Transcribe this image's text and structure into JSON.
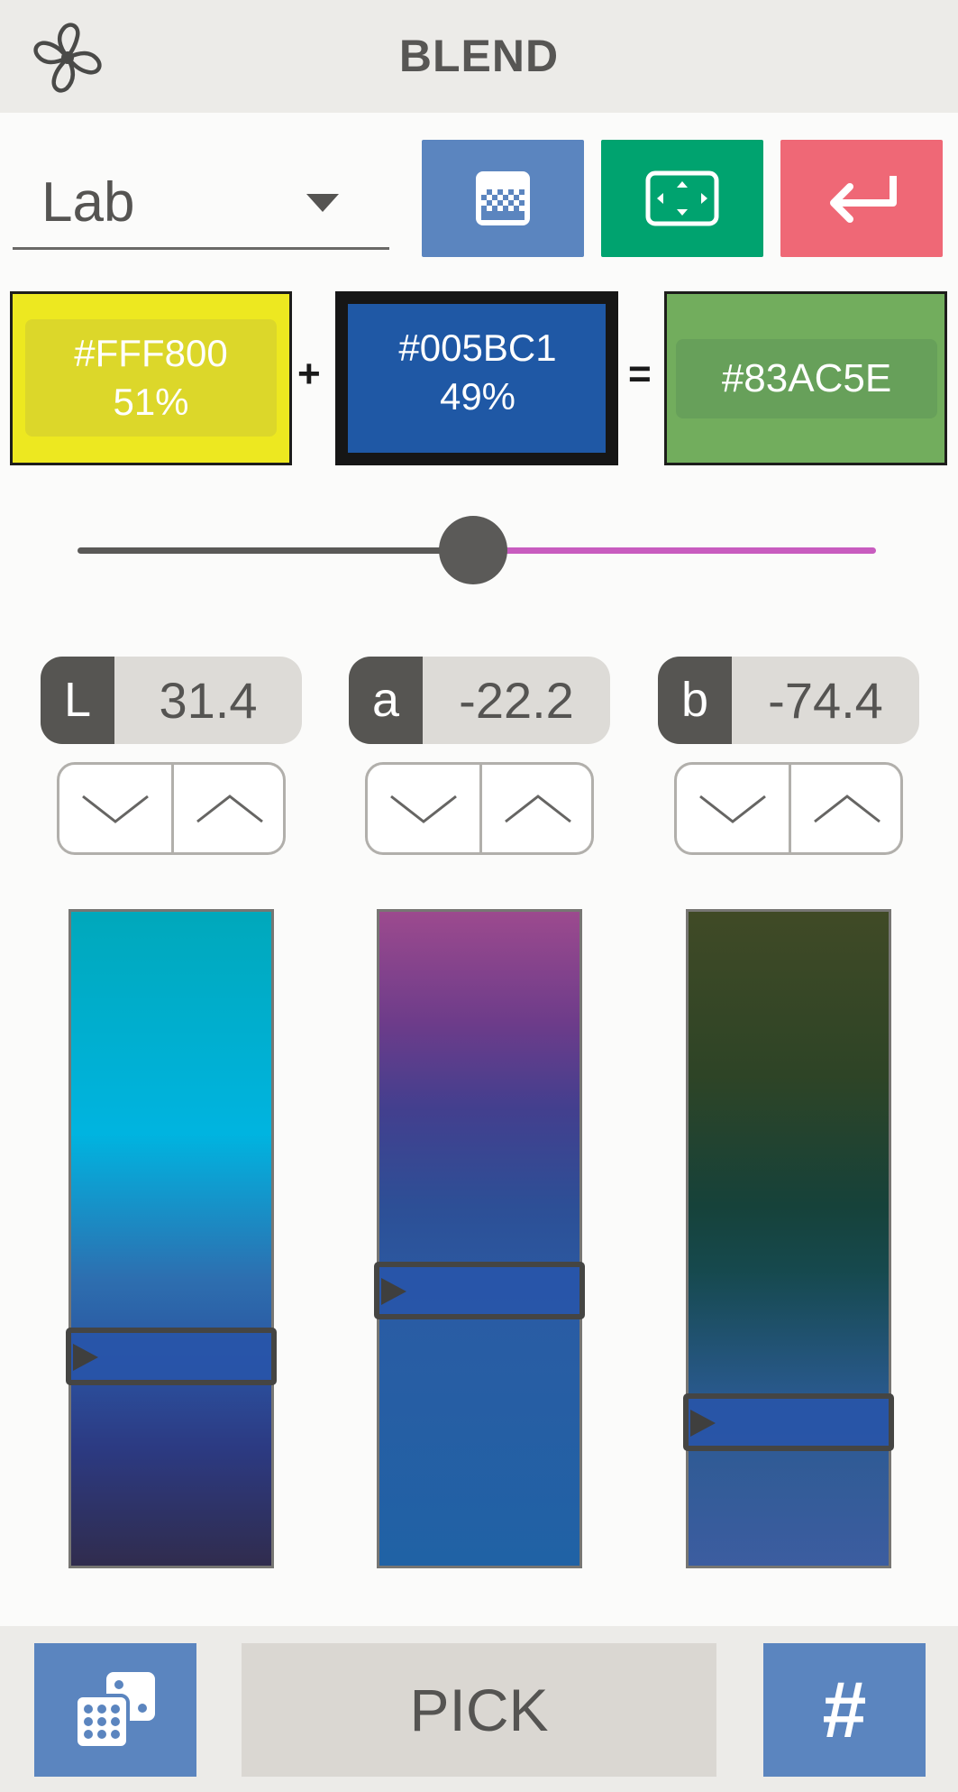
{
  "header": {
    "title": "BLEND",
    "icon": "fan-icon"
  },
  "toolbar": {
    "mode": "Lab",
    "grid_icon": "grid-pattern-icon",
    "fullscreen_icon": "fullscreen-icon",
    "return_icon": "return-arrow-icon"
  },
  "blend": {
    "color_a": {
      "hex": "#FFF800",
      "percent": "51%"
    },
    "color_b": {
      "hex": "#005BC1",
      "percent": "49%"
    },
    "plus": "+",
    "equals": "=",
    "result": {
      "hex": "#83AC5E"
    },
    "slider_fraction": 0.49
  },
  "channels": [
    {
      "letter": "L",
      "value": "31.4",
      "marker_fraction": 0.68
    },
    {
      "letter": "a",
      "value": "-22.2",
      "marker_fraction": 0.58
    },
    {
      "letter": "b",
      "value": "-74.4",
      "marker_fraction": 0.78
    }
  ],
  "footer": {
    "random_icon": "dice-icon",
    "pick_label": "PICK",
    "hex_label": "#"
  },
  "colors": {
    "header_bg": "#ECEBE8",
    "accent_blue": "#5B85BF",
    "accent_green": "#00A36F",
    "accent_red": "#EF6876",
    "slider_right": "#C85CBF",
    "color_a": "#FFF800",
    "color_b": "#005BC1",
    "result": "#83AC5E"
  }
}
